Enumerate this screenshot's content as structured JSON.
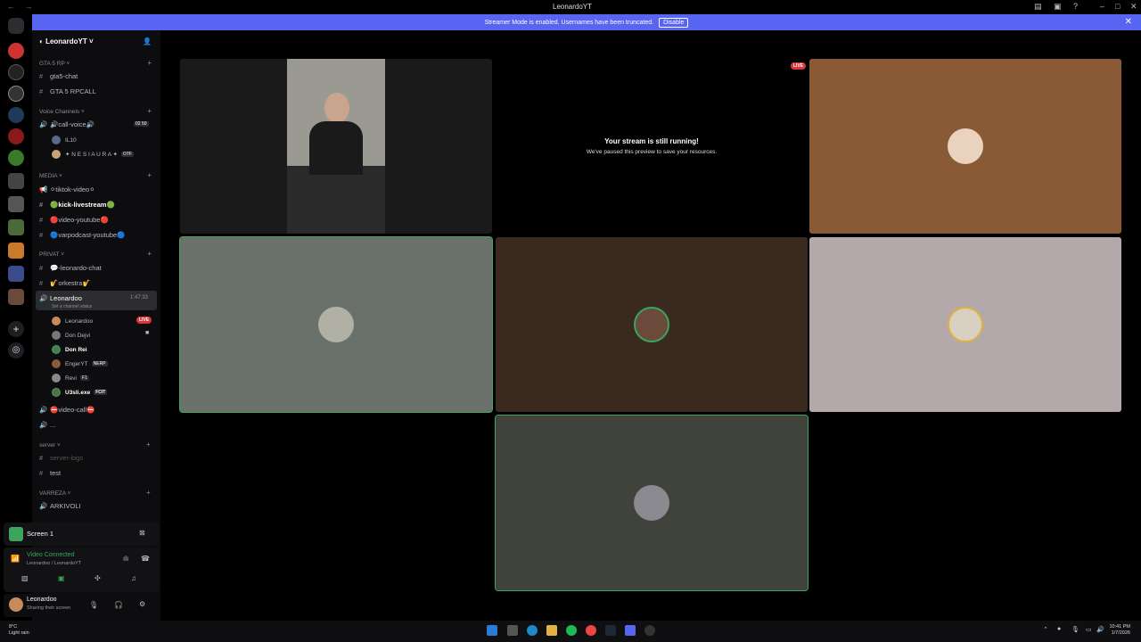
{
  "window": {
    "title": "LeonardoYT",
    "nav": "← →"
  },
  "banner": {
    "text": "Streamer Mode is enabled. Usernames have been truncated.",
    "disable_label": "Disable"
  },
  "guild": {
    "name": "LeonardoYT"
  },
  "categories": {
    "gta": "GTA 5 RP",
    "voice": "Voice Channels",
    "media": "MEDIA",
    "privat": "PRIVAT",
    "server": "server",
    "varreza": "VARREZA"
  },
  "channels": {
    "gta5_chat": "gta5-chat",
    "gta5_rpcall": "GTA 5 RPCALL",
    "call_voice": "call-voice",
    "call_voice_counts": "02  50",
    "tiktok": "tiktok-video",
    "kick": "kick-livestream",
    "youtube": "video-youtube",
    "varpodcast": "varpodcast-youtube",
    "leonardo_chat": "-leonardo-chat",
    "orkestra": "orkestra",
    "leonardoo": "Leonardoo",
    "leonardoo_timer": "1:47:33",
    "channel_status": "Set a channel status",
    "video_call": "video-call",
    "dots": "...",
    "server_logs": "server-logs",
    "test": "test",
    "arkivoli": "ARKIVOLI"
  },
  "voice_users": {
    "call1": "IL10",
    "call2": "✦ N E S I A U R A ✦",
    "call2_badge": "OTF"
  },
  "leonardoo_users": [
    {
      "name": "Leonardoo",
      "badge": "LIVE"
    },
    {
      "name": "Don Dejvi",
      "badge": ""
    },
    {
      "name": "Don Rei",
      "badge": ""
    },
    {
      "name": "EngerYT",
      "badge": "NERP"
    },
    {
      "name": "Revi",
      "badge": "F1"
    },
    {
      "name": "U3sli.exe",
      "badge": "FCIT"
    }
  ],
  "screen_panel": {
    "title": "Screen 1"
  },
  "voice_panel": {
    "status": "Video Connected",
    "location": "Leonardoo / LeonardoYT"
  },
  "user_panel": {
    "name": "Leonardoo",
    "status": "Sharing their screen"
  },
  "stage": {
    "live_badge": "LIVE",
    "paused_title": "Your stream is still running!",
    "paused_subtitle": "We've paused this preview to save your resources."
  },
  "taskbar": {
    "temp": "8°C",
    "weather": "Light rain",
    "time": "10:41 PM",
    "date": "1/7/2026"
  },
  "colors": {
    "accent": "#5865f2",
    "speaking": "#3ba55c",
    "live": "#da373c",
    "tile_brown": "#8a5a36",
    "tile_gray": "#6a716b",
    "tile_dark_brown": "#3a291f",
    "tile_light": "#b3a9aa",
    "tile_olive": "#3f433c"
  }
}
